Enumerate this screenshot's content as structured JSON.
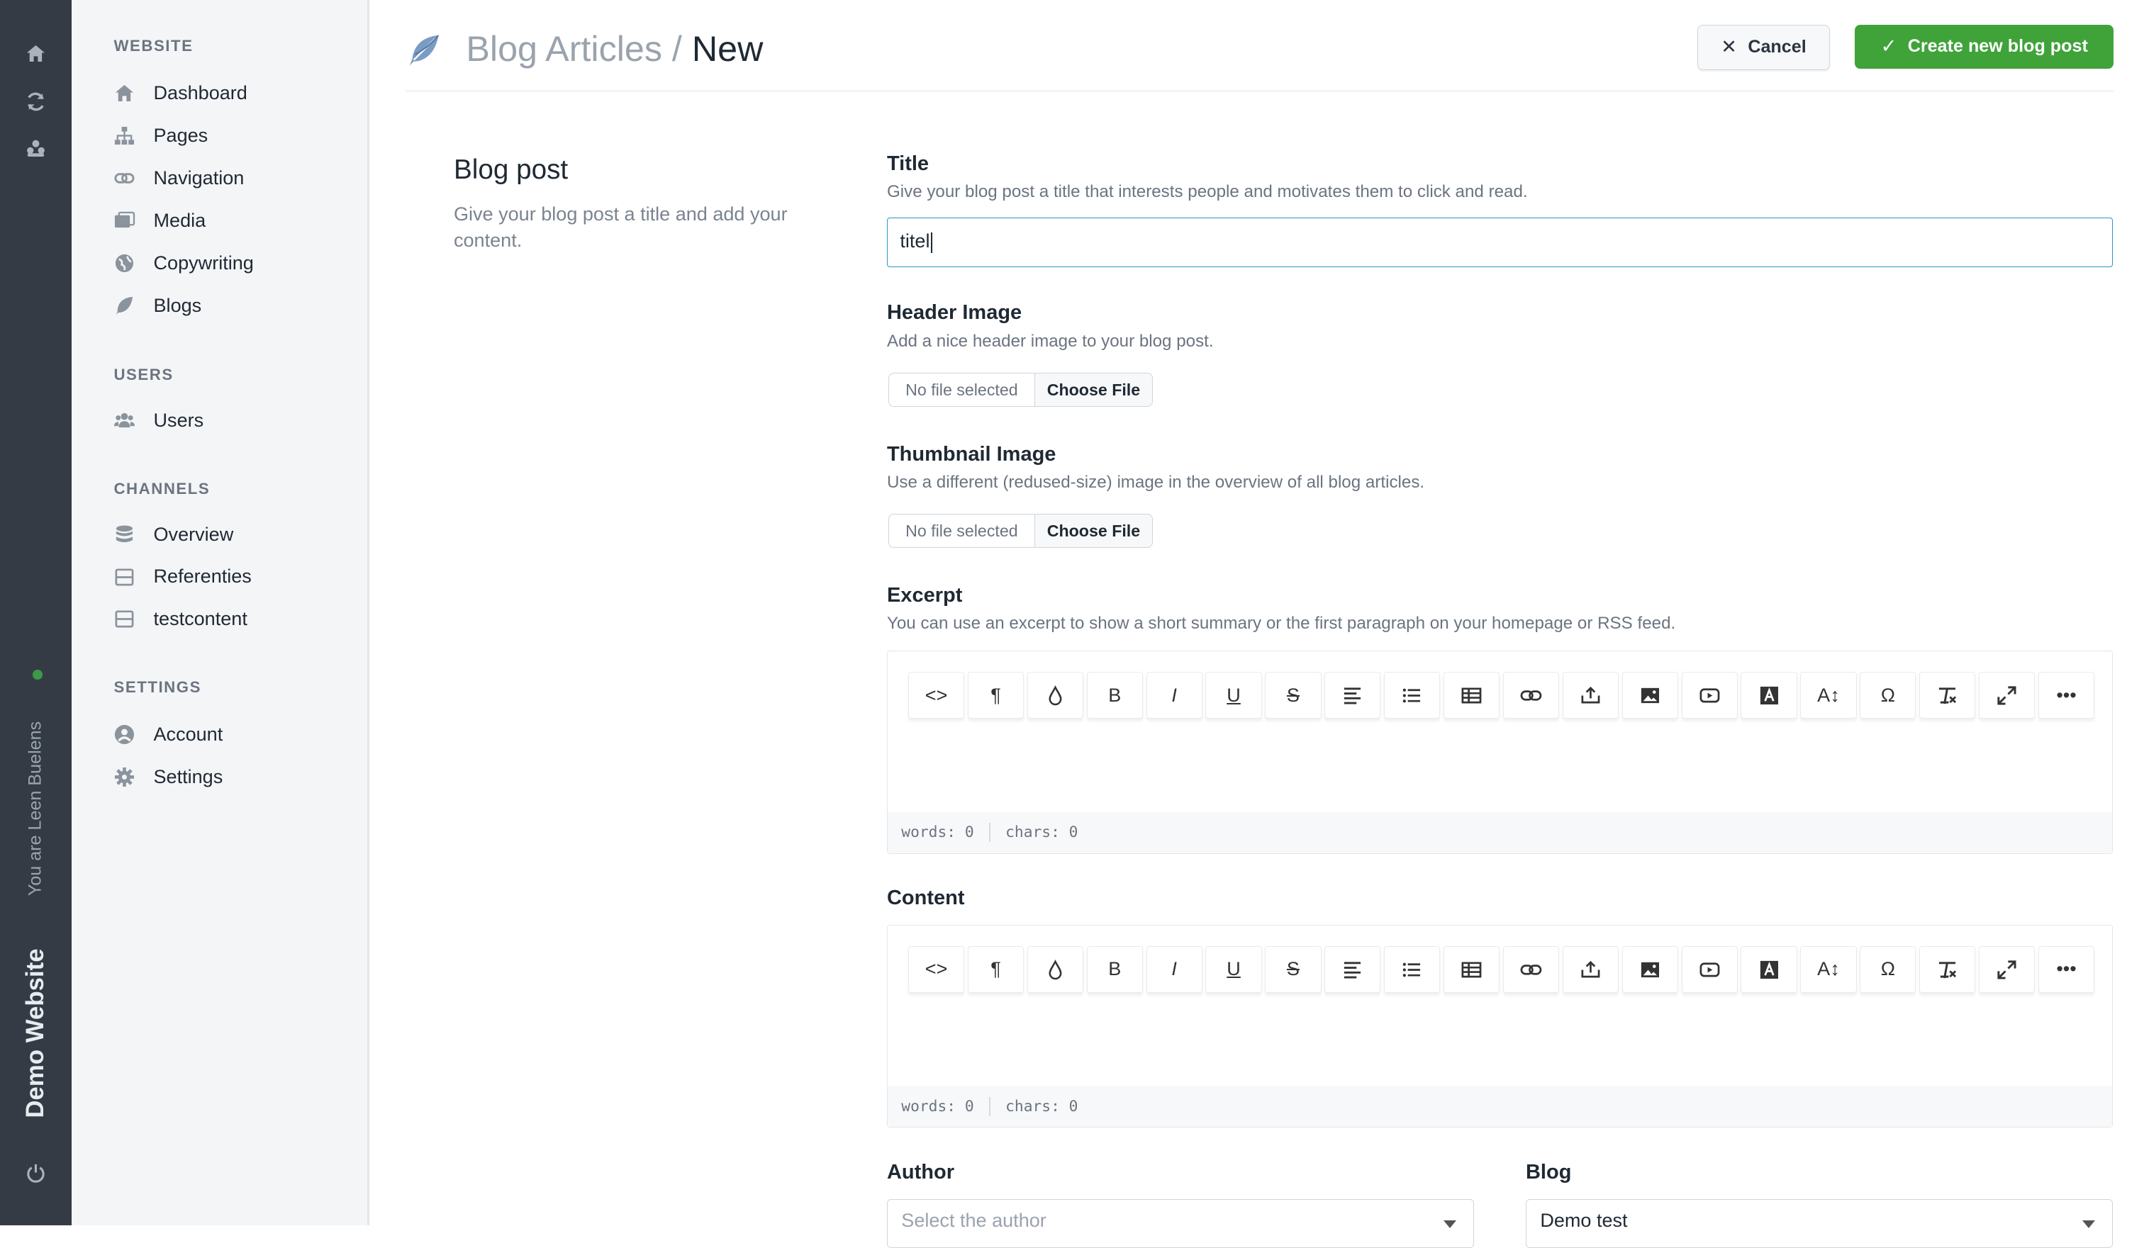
{
  "rail": {
    "icons": [
      "home-icon",
      "refresh-icon",
      "users-group-icon",
      "power-icon"
    ],
    "user_text": "You are Leen Buelens",
    "site_name": "Demo Website"
  },
  "sidebar": {
    "sections": [
      {
        "title": "WEBSITE",
        "items": [
          {
            "label": "Dashboard",
            "icon": "home-icon"
          },
          {
            "label": "Pages",
            "icon": "sitemap-icon"
          },
          {
            "label": "Navigation",
            "icon": "link-icon"
          },
          {
            "label": "Media",
            "icon": "images-icon"
          },
          {
            "label": "Copywriting",
            "icon": "globe-icon"
          },
          {
            "label": "Blogs",
            "icon": "feather-icon"
          }
        ]
      },
      {
        "title": "USERS",
        "items": [
          {
            "label": "Users",
            "icon": "users-icon"
          }
        ]
      },
      {
        "title": "CHANNELS",
        "items": [
          {
            "label": "Overview",
            "icon": "database-icon"
          },
          {
            "label": "Referenties",
            "icon": "box-icon"
          },
          {
            "label": "testcontent",
            "icon": "box-icon"
          }
        ]
      },
      {
        "title": "SETTINGS",
        "items": [
          {
            "label": "Account",
            "icon": "user-circle-icon"
          },
          {
            "label": "Settings",
            "icon": "gear-icon"
          }
        ]
      }
    ]
  },
  "header": {
    "breadcrumb_parent": "Blog Articles",
    "breadcrumb_separator": " / ",
    "breadcrumb_current": "New",
    "cancel_label": "Cancel",
    "create_label": "Create new blog post"
  },
  "intro": {
    "title": "Blog post",
    "description": "Give your blog post a title and add your content."
  },
  "form": {
    "title": {
      "label": "Title",
      "help": "Give your blog post a title that interests people and motivates them to click and read.",
      "value": "titel"
    },
    "header_image": {
      "label": "Header Image",
      "help": "Add a nice header image to your blog post.",
      "file_status": "No file selected",
      "button": "Choose File"
    },
    "thumbnail_image": {
      "label": "Thumbnail Image",
      "help": "Use a different (redused-size) image in the overview of all blog articles.",
      "file_status": "No file selected",
      "button": "Choose File"
    },
    "excerpt": {
      "label": "Excerpt",
      "help": "You can use an excerpt to show a short summary or the first paragraph on your homepage or RSS feed.",
      "words": "words: 0",
      "chars": "chars: 0"
    },
    "content": {
      "label": "Content",
      "words": "words: 0",
      "chars": "chars: 0"
    },
    "author": {
      "label": "Author",
      "placeholder": "Select the author"
    },
    "blog": {
      "label": "Blog",
      "value": "Demo test"
    }
  },
  "toolbar_buttons": [
    "code-view-icon",
    "paragraph-icon",
    "color-drop-icon",
    "bold-icon",
    "italic-icon",
    "underline-icon",
    "strikethrough-icon",
    "align-icon",
    "list-icon",
    "table-icon",
    "link-icon",
    "upload-icon",
    "image-icon",
    "video-icon",
    "font-icon",
    "text-size-icon",
    "special-chars-icon",
    "clear-format-icon",
    "fullscreen-icon",
    "more-icon"
  ],
  "colors": {
    "primary": "#3fa33a",
    "rail": "#343b44",
    "focus": "#2c94c6"
  }
}
